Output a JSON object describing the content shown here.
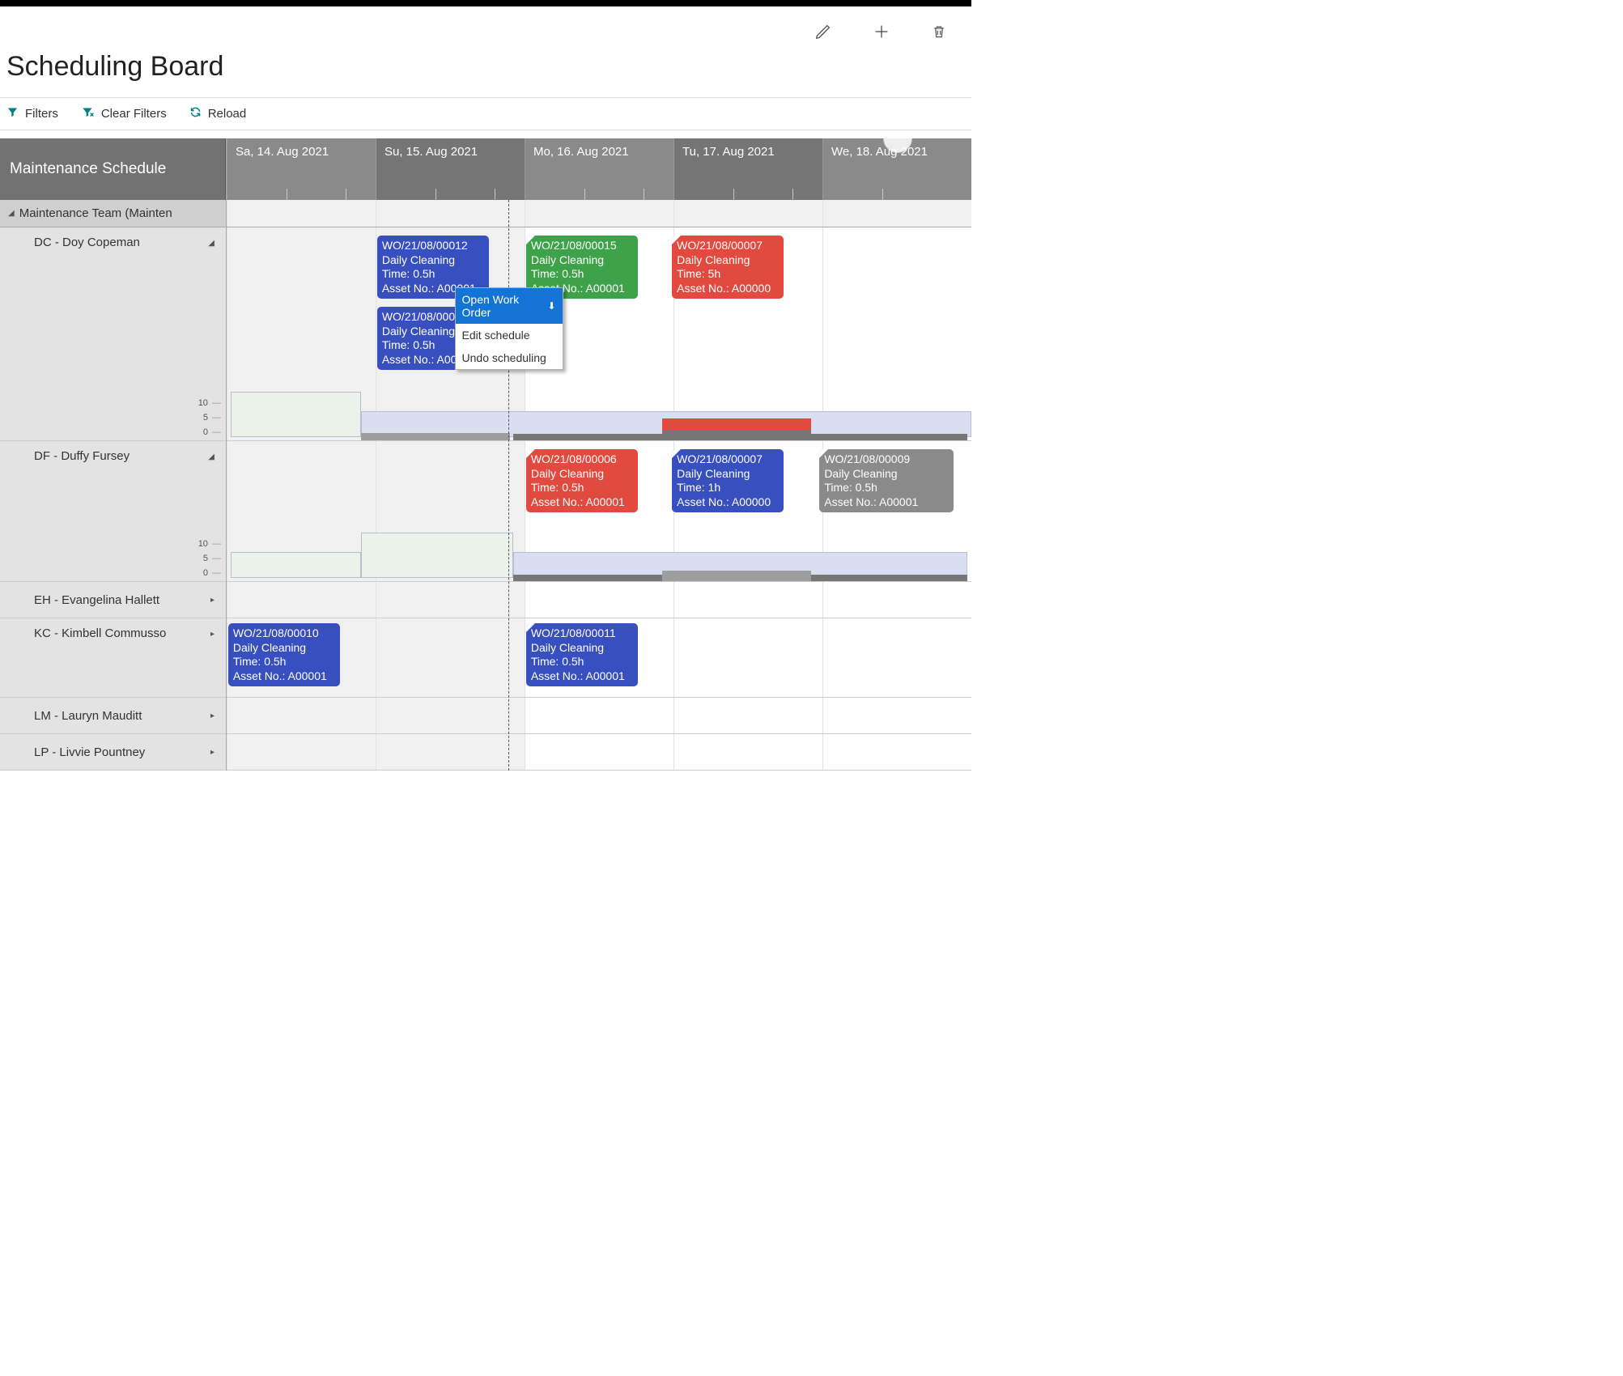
{
  "page": {
    "title": "Scheduling Board"
  },
  "toolbar": {
    "filters": "Filters",
    "clear_filters": "Clear Filters",
    "reload": "Reload"
  },
  "board_header": "Maintenance Schedule",
  "days": [
    {
      "label": "Sa, 14. Aug 2021",
      "weekend": true
    },
    {
      "label": "Su, 15. Aug 2021",
      "weekend": true
    },
    {
      "label": "Mo, 16. Aug 2021",
      "weekend": false
    },
    {
      "label": "Tu, 17. Aug 2021",
      "weekend": false
    },
    {
      "label": "We, 18. Aug 2021",
      "weekend": false
    }
  ],
  "team": {
    "name": "Maintenance Team (Mainten"
  },
  "resources": [
    {
      "code": "DC",
      "name": "DC - Doy Copeman",
      "expanded": true
    },
    {
      "code": "DF",
      "name": "DF - Duffy Fursey",
      "expanded": true
    },
    {
      "code": "EH",
      "name": "EH - Evangelina Hallett",
      "expanded": false
    },
    {
      "code": "KC",
      "name": "KC - Kimbell Commusso",
      "expanded": false
    },
    {
      "code": "LM",
      "name": "LM - Lauryn Mauditt",
      "expanded": false
    },
    {
      "code": "LP",
      "name": "LP - Livvie Pountney",
      "expanded": false
    }
  ],
  "y_ticks": [
    "10",
    "5",
    "0"
  ],
  "cards": {
    "dc": [
      {
        "wo": "WO/21/08/00012",
        "desc": "Daily Cleaning",
        "time": "Time: 0.5h",
        "asset": "Asset No.: A00001"
      },
      {
        "wo": "WO/21/08/00013",
        "desc": "Daily Cleaning",
        "time": "Time: 0.5h",
        "asset": "Asset No.: A00001"
      },
      {
        "wo": "WO/21/08/00015",
        "desc": "Daily Cleaning",
        "time": "Time: 0.5h",
        "asset": "Asset No.: A00001"
      },
      {
        "wo": "WO/21/08/00007",
        "desc": "Daily Cleaning",
        "time": "Time: 5h",
        "asset": "Asset No.: A00000"
      }
    ],
    "df": [
      {
        "wo": "WO/21/08/00006",
        "desc": "Daily Cleaning",
        "time": "Time: 0.5h",
        "asset": "Asset No.: A00001"
      },
      {
        "wo": "WO/21/08/00007",
        "desc": "Daily Cleaning",
        "time": "Time: 1h",
        "asset": "Asset No.: A00000"
      },
      {
        "wo": "WO/21/08/00009",
        "desc": "Daily Cleaning",
        "time": "Time: 0.5h",
        "asset": "Asset No.: A00001"
      }
    ],
    "kc": [
      {
        "wo": "WO/21/08/00010",
        "desc": "Daily Cleaning",
        "time": "Time: 0.5h",
        "asset": "Asset No.: A00001"
      },
      {
        "wo": "WO/21/08/00011",
        "desc": "Daily Cleaning",
        "time": "Time: 0.5h",
        "asset": "Asset No.: A00001"
      }
    ]
  },
  "context_menu": {
    "open": "Open Work Order",
    "edit": "Edit schedule",
    "undo": "Undo scheduling"
  }
}
